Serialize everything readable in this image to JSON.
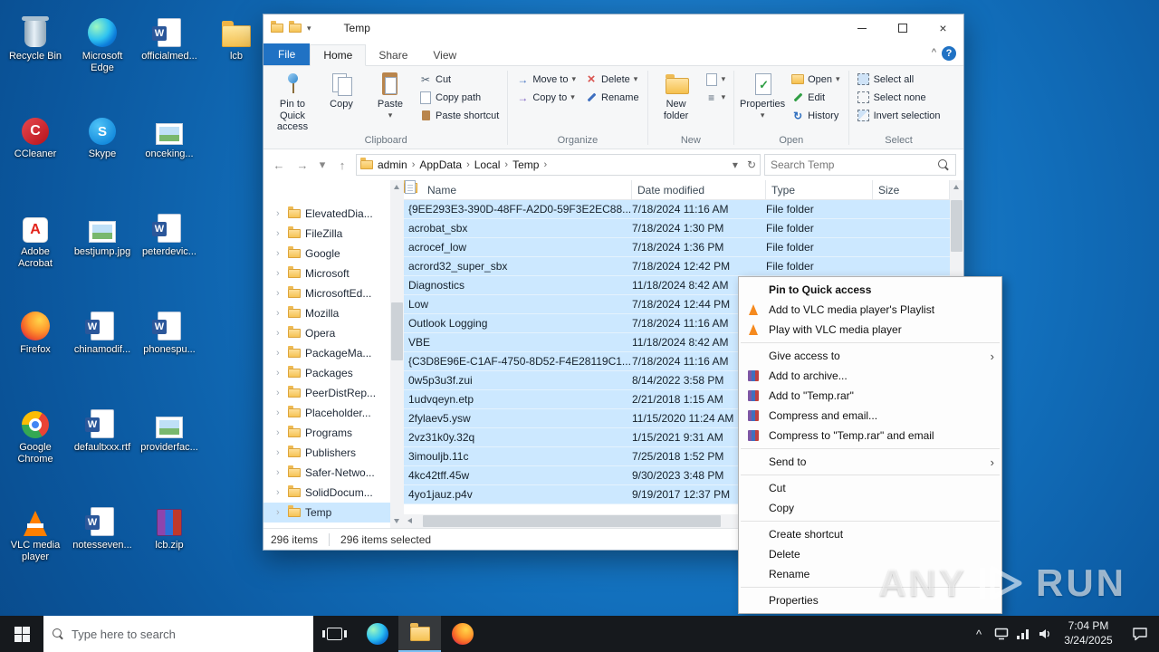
{
  "theme": {
    "selection": "#cce8ff",
    "accent_blue": "#2072c4",
    "taskbar_bg": "#16191d",
    "folder_yellow": "#f5c04e"
  },
  "glyphs": {
    "caret_down": "▾",
    "chevron": "›",
    "back": "←",
    "forward": "→",
    "up": "↑",
    "refresh": "↻",
    "collapse": "^",
    "help": "?",
    "close": "×"
  },
  "watermark": {
    "left": "ANY",
    "right": "RUN"
  },
  "desktop": {
    "icons": [
      {
        "label": "Recycle Bin",
        "icon": "recycle-bin"
      },
      {
        "label": "CCleaner",
        "icon": "ccleaner"
      },
      {
        "label": "Adobe Acrobat",
        "icon": "acrobat"
      },
      {
        "label": "Firefox",
        "icon": "firefox"
      },
      {
        "label": "Google Chrome",
        "icon": "chrome"
      },
      {
        "label": "VLC media player",
        "icon": "vlc"
      },
      {
        "label": "Microsoft Edge",
        "icon": "edge"
      },
      {
        "label": "Skype",
        "icon": "skype"
      },
      {
        "label": "bestjump.jpg",
        "icon": "image"
      },
      {
        "label": "chinamodif...",
        "icon": "word"
      },
      {
        "label": "defaultxxx.rtf",
        "icon": "word"
      },
      {
        "label": "notesseven...",
        "icon": "word"
      },
      {
        "label": "officialmed...",
        "icon": "word"
      },
      {
        "label": "onceking...",
        "icon": "image"
      },
      {
        "label": "peterdevic...",
        "icon": "word"
      },
      {
        "label": "phonespu...",
        "icon": "word"
      },
      {
        "label": "providerfac...",
        "icon": "image"
      },
      {
        "label": "lcb.zip",
        "icon": "zip"
      },
      {
        "label": "lcb",
        "icon": "folder"
      }
    ]
  },
  "explorer": {
    "title": "Temp",
    "tabs": {
      "file": "File",
      "items": [
        "Home",
        "Share",
        "View"
      ],
      "active": "Home"
    },
    "ribbon": {
      "pin": "Pin to Quick access",
      "copy": "Copy",
      "paste": "Paste",
      "cut": "Cut",
      "copy_path": "Copy path",
      "paste_shortcut": "Paste shortcut",
      "move_to": "Move to",
      "copy_to": "Copy to",
      "delete": "Delete",
      "rename": "Rename",
      "new_folder": "New folder",
      "properties": "Properties",
      "open": "Open",
      "edit": "Edit",
      "history": "History",
      "select_all": "Select all",
      "select_none": "Select none",
      "invert_selection": "Invert selection",
      "groups": {
        "clipboard": "Clipboard",
        "organize": "Organize",
        "new": "New",
        "open": "Open",
        "select": "Select"
      }
    },
    "address": {
      "crumbs": [
        "admin",
        "AppData",
        "Local",
        "Temp"
      ]
    },
    "search": {
      "placeholder": "Search Temp"
    },
    "tree": [
      {
        "label": "ElevatedDia..."
      },
      {
        "label": "FileZilla"
      },
      {
        "label": "Google"
      },
      {
        "label": "Microsoft"
      },
      {
        "label": "MicrosoftEd..."
      },
      {
        "label": "Mozilla"
      },
      {
        "label": "Opera"
      },
      {
        "label": "PackageMa..."
      },
      {
        "label": "Packages"
      },
      {
        "label": "PeerDistRep..."
      },
      {
        "label": "Placeholder..."
      },
      {
        "label": "Programs"
      },
      {
        "label": "Publishers"
      },
      {
        "label": "Safer-Netwo..."
      },
      {
        "label": "SolidDocum..."
      },
      {
        "label": "Temp",
        "selected": true
      }
    ],
    "list": {
      "columns": [
        "Name",
        "Date modified",
        "Type",
        "Size"
      ],
      "rows": [
        {
          "name": "{9EE293E3-390D-48FF-A2D0-59F3E2EC88...",
          "date": "7/18/2024 11:16 AM",
          "type": "File folder",
          "icon": "folder"
        },
        {
          "name": "acrobat_sbx",
          "date": "7/18/2024 1:30 PM",
          "type": "File folder",
          "icon": "folder"
        },
        {
          "name": "acrocef_low",
          "date": "7/18/2024 1:36 PM",
          "type": "File folder",
          "icon": "folder"
        },
        {
          "name": "acrord32_super_sbx",
          "date": "7/18/2024 12:42 PM",
          "type": "File folder",
          "icon": "folder"
        },
        {
          "name": "Diagnostics",
          "date": "11/18/2024 8:42 AM",
          "type": "",
          "icon": "folder"
        },
        {
          "name": "Low",
          "date": "7/18/2024 12:44 PM",
          "type": "",
          "icon": "folder"
        },
        {
          "name": "Outlook Logging",
          "date": "7/18/2024 11:16 AM",
          "type": "",
          "icon": "folder"
        },
        {
          "name": "VBE",
          "date": "11/18/2024 8:42 AM",
          "type": "",
          "icon": "folder"
        },
        {
          "name": "{C3D8E96E-C1AF-4750-8D52-F4E28119C1...",
          "date": "7/18/2024 11:16 AM",
          "type": "",
          "icon": "file"
        },
        {
          "name": "0w5p3u3f.zui",
          "date": "8/14/2022 3:58 PM",
          "type": "",
          "icon": "file"
        },
        {
          "name": "1udvqeyn.etp",
          "date": "2/21/2018 1:15 AM",
          "type": "",
          "icon": "file"
        },
        {
          "name": "2fylaev5.ysw",
          "date": "11/15/2020 11:24 AM",
          "type": "",
          "icon": "file"
        },
        {
          "name": "2vz31k0y.32q",
          "date": "1/15/2021 9:31 AM",
          "type": "",
          "icon": "file"
        },
        {
          "name": "3imouljb.11c",
          "date": "7/25/2018 1:52 PM",
          "type": "",
          "icon": "file"
        },
        {
          "name": "4kc42tff.45w",
          "date": "9/30/2023 3:48 PM",
          "type": "",
          "icon": "file"
        },
        {
          "name": "4yo1jauz.p4v",
          "date": "9/19/2017 12:37 PM",
          "type": "",
          "icon": "file"
        }
      ]
    },
    "status": {
      "count": "296 items",
      "selected": "296 items selected"
    }
  },
  "context_menu": {
    "items": [
      {
        "label": "Pin to Quick access",
        "bold": true
      },
      {
        "label": "Add to VLC media player's Playlist",
        "icon": "vlc"
      },
      {
        "label": "Play with VLC media player",
        "icon": "vlc"
      },
      {
        "sep": true
      },
      {
        "label": "Give access to",
        "submenu": true
      },
      {
        "label": "Add to archive...",
        "icon": "winrar"
      },
      {
        "label": "Add to \"Temp.rar\"",
        "icon": "winrar"
      },
      {
        "label": "Compress and email...",
        "icon": "winrar"
      },
      {
        "label": "Compress to \"Temp.rar\" and email",
        "icon": "winrar"
      },
      {
        "sep": true
      },
      {
        "label": "Send to",
        "submenu": true
      },
      {
        "sep": true
      },
      {
        "label": "Cut"
      },
      {
        "label": "Copy"
      },
      {
        "sep": true
      },
      {
        "label": "Create shortcut"
      },
      {
        "label": "Delete"
      },
      {
        "label": "Rename"
      },
      {
        "sep": true
      },
      {
        "label": "Properties"
      }
    ]
  },
  "taskbar": {
    "search_placeholder": "Type here to search",
    "time": "7:04 PM",
    "date": "3/24/2025"
  }
}
